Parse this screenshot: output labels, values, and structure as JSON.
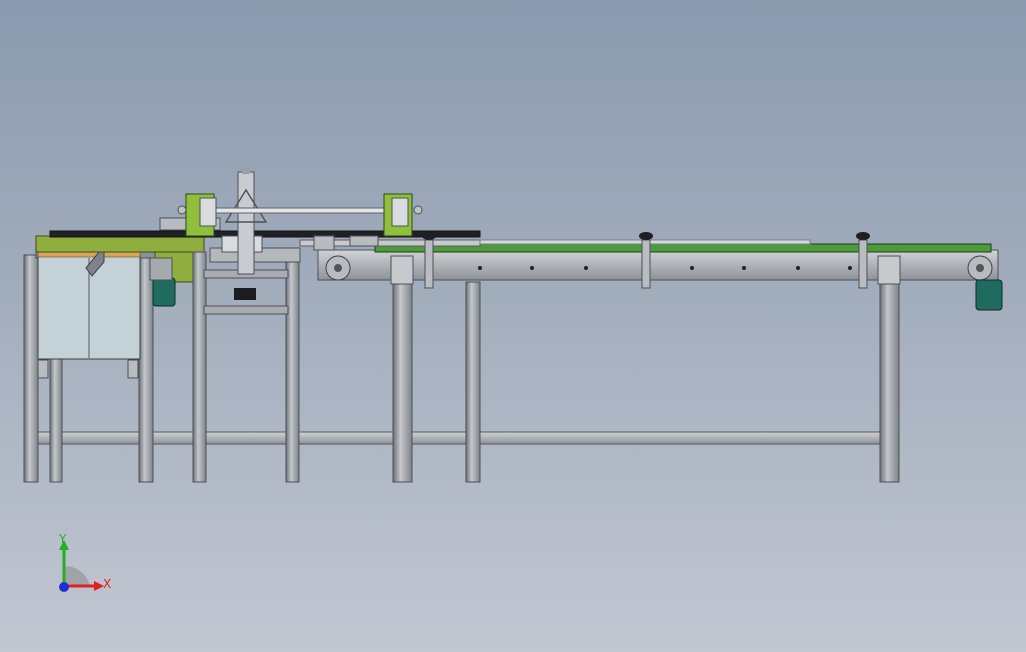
{
  "view": {
    "background_top": "#8b9aae",
    "background_bottom": "#c2c7d2"
  },
  "triad": {
    "x_label": "X",
    "y_label": "Y",
    "x_color": "#e02020",
    "y_color": "#22b022",
    "z_color": "#2030d0"
  },
  "palette": {
    "frame": "#a9aeb3",
    "frame_dark": "#5e6368",
    "belt": "#4d9a3a",
    "plate": "#8fae3e",
    "motor": "#1f6b5f",
    "guard": "#c3d1d6"
  }
}
